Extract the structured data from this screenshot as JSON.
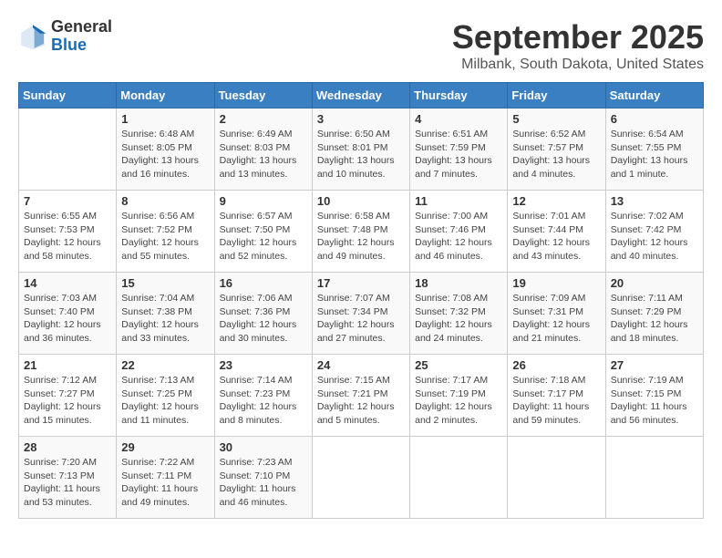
{
  "header": {
    "logo_general": "General",
    "logo_blue": "Blue",
    "title": "September 2025",
    "subtitle": "Milbank, South Dakota, United States"
  },
  "calendar": {
    "days_of_week": [
      "Sunday",
      "Monday",
      "Tuesday",
      "Wednesday",
      "Thursday",
      "Friday",
      "Saturday"
    ],
    "weeks": [
      [
        {
          "day": null,
          "info": null
        },
        {
          "day": "1",
          "sunrise": "6:48 AM",
          "sunset": "8:05 PM",
          "daylight": "13 hours and 16 minutes."
        },
        {
          "day": "2",
          "sunrise": "6:49 AM",
          "sunset": "8:03 PM",
          "daylight": "13 hours and 13 minutes."
        },
        {
          "day": "3",
          "sunrise": "6:50 AM",
          "sunset": "8:01 PM",
          "daylight": "13 hours and 10 minutes."
        },
        {
          "day": "4",
          "sunrise": "6:51 AM",
          "sunset": "7:59 PM",
          "daylight": "13 hours and 7 minutes."
        },
        {
          "day": "5",
          "sunrise": "6:52 AM",
          "sunset": "7:57 PM",
          "daylight": "13 hours and 4 minutes."
        },
        {
          "day": "6",
          "sunrise": "6:54 AM",
          "sunset": "7:55 PM",
          "daylight": "13 hours and 1 minute."
        }
      ],
      [
        {
          "day": "7",
          "sunrise": "6:55 AM",
          "sunset": "7:53 PM",
          "daylight": "12 hours and 58 minutes."
        },
        {
          "day": "8",
          "sunrise": "6:56 AM",
          "sunset": "7:52 PM",
          "daylight": "12 hours and 55 minutes."
        },
        {
          "day": "9",
          "sunrise": "6:57 AM",
          "sunset": "7:50 PM",
          "daylight": "12 hours and 52 minutes."
        },
        {
          "day": "10",
          "sunrise": "6:58 AM",
          "sunset": "7:48 PM",
          "daylight": "12 hours and 49 minutes."
        },
        {
          "day": "11",
          "sunrise": "7:00 AM",
          "sunset": "7:46 PM",
          "daylight": "12 hours and 46 minutes."
        },
        {
          "day": "12",
          "sunrise": "7:01 AM",
          "sunset": "7:44 PM",
          "daylight": "12 hours and 43 minutes."
        },
        {
          "day": "13",
          "sunrise": "7:02 AM",
          "sunset": "7:42 PM",
          "daylight": "12 hours and 40 minutes."
        }
      ],
      [
        {
          "day": "14",
          "sunrise": "7:03 AM",
          "sunset": "7:40 PM",
          "daylight": "12 hours and 36 minutes."
        },
        {
          "day": "15",
          "sunrise": "7:04 AM",
          "sunset": "7:38 PM",
          "daylight": "12 hours and 33 minutes."
        },
        {
          "day": "16",
          "sunrise": "7:06 AM",
          "sunset": "7:36 PM",
          "daylight": "12 hours and 30 minutes."
        },
        {
          "day": "17",
          "sunrise": "7:07 AM",
          "sunset": "7:34 PM",
          "daylight": "12 hours and 27 minutes."
        },
        {
          "day": "18",
          "sunrise": "7:08 AM",
          "sunset": "7:32 PM",
          "daylight": "12 hours and 24 minutes."
        },
        {
          "day": "19",
          "sunrise": "7:09 AM",
          "sunset": "7:31 PM",
          "daylight": "12 hours and 21 minutes."
        },
        {
          "day": "20",
          "sunrise": "7:11 AM",
          "sunset": "7:29 PM",
          "daylight": "12 hours and 18 minutes."
        }
      ],
      [
        {
          "day": "21",
          "sunrise": "7:12 AM",
          "sunset": "7:27 PM",
          "daylight": "12 hours and 15 minutes."
        },
        {
          "day": "22",
          "sunrise": "7:13 AM",
          "sunset": "7:25 PM",
          "daylight": "12 hours and 11 minutes."
        },
        {
          "day": "23",
          "sunrise": "7:14 AM",
          "sunset": "7:23 PM",
          "daylight": "12 hours and 8 minutes."
        },
        {
          "day": "24",
          "sunrise": "7:15 AM",
          "sunset": "7:21 PM",
          "daylight": "12 hours and 5 minutes."
        },
        {
          "day": "25",
          "sunrise": "7:17 AM",
          "sunset": "7:19 PM",
          "daylight": "12 hours and 2 minutes."
        },
        {
          "day": "26",
          "sunrise": "7:18 AM",
          "sunset": "7:17 PM",
          "daylight": "11 hours and 59 minutes."
        },
        {
          "day": "27",
          "sunrise": "7:19 AM",
          "sunset": "7:15 PM",
          "daylight": "11 hours and 56 minutes."
        }
      ],
      [
        {
          "day": "28",
          "sunrise": "7:20 AM",
          "sunset": "7:13 PM",
          "daylight": "11 hours and 53 minutes."
        },
        {
          "day": "29",
          "sunrise": "7:22 AM",
          "sunset": "7:11 PM",
          "daylight": "11 hours and 49 minutes."
        },
        {
          "day": "30",
          "sunrise": "7:23 AM",
          "sunset": "7:10 PM",
          "daylight": "11 hours and 46 minutes."
        },
        {
          "day": null,
          "info": null
        },
        {
          "day": null,
          "info": null
        },
        {
          "day": null,
          "info": null
        },
        {
          "day": null,
          "info": null
        }
      ]
    ]
  }
}
